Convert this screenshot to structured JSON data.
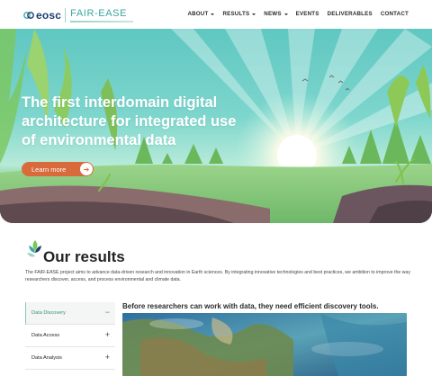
{
  "header": {
    "logo_eosc": "eosc",
    "logo_project": "FAIR-EASE",
    "nav": [
      {
        "label": "ABOUT",
        "has_dropdown": true
      },
      {
        "label": "RESULTS",
        "has_dropdown": true
      },
      {
        "label": "NEWS",
        "has_dropdown": true
      },
      {
        "label": "EVENTS",
        "has_dropdown": false
      },
      {
        "label": "DELIVERABLES",
        "has_dropdown": false
      },
      {
        "label": "CONTACT",
        "has_dropdown": false
      }
    ]
  },
  "hero": {
    "title": "The first interdomain digital architecture for integrated use of environmental data",
    "cta_label": "Learn more",
    "cta_icon": "arrow-right-icon"
  },
  "results": {
    "title": "Our results",
    "description": "The FAIR-EASE project aims to advance data-driven research and innovation in Earth sciences. By integrating innovative technologies and best practices, we ambition to improve the way researchers discover, access, and process environmental and climate data.",
    "tabs": [
      {
        "label": "Data Discovery",
        "active": true,
        "icon": "minus-icon"
      },
      {
        "label": "Data Access",
        "active": false,
        "icon": "plus-icon"
      },
      {
        "label": "Data Analysis",
        "active": false,
        "icon": "plus-icon"
      }
    ],
    "panel_heading": "Before researchers can work with data, they need efficient discovery tools."
  },
  "colors": {
    "accent_orange": "#d96a3c",
    "teal": "#3aa6a0",
    "navy": "#1c3d6e",
    "active_green": "#3b8f7c"
  }
}
